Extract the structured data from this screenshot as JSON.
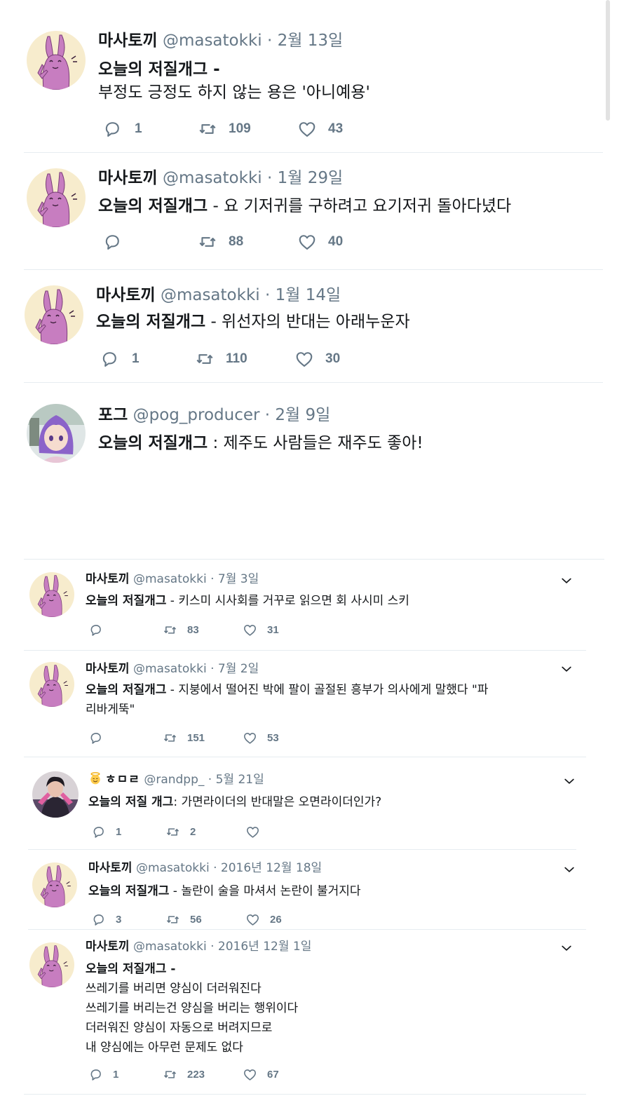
{
  "tweets": [
    {
      "name": "마사토끼",
      "handle": "@masatokki",
      "date": "2월 13일",
      "headline": "오늘의 저질개그 -",
      "lines": [
        "부정도 긍정도 하지 않는 용은 '아니예용'"
      ],
      "replies": "1",
      "retweets": "109",
      "likes": "43"
    },
    {
      "name": "마사토끼",
      "handle": "@masatokki",
      "date": "1월 29일",
      "headline": "오늘의 저질개그",
      "lines": [
        " - 요 기저귀를 구하려고 요기저귀 돌아다녔다"
      ],
      "replies": "",
      "retweets": "88",
      "likes": "40"
    },
    {
      "name": "마사토끼",
      "handle": "@masatokki",
      "date": "1월 14일",
      "headline": "오늘의 저질개그",
      "lines": [
        " - 위선자의 반대는 아래누운자"
      ],
      "replies": "1",
      "retweets": "110",
      "likes": "30"
    },
    {
      "name": "포그",
      "handle": "@pog_producer",
      "date": "2월 9일",
      "headline": "오늘의 저질개그",
      "lines": [
        " : 제주도 사람들은 재주도 좋아!"
      ]
    },
    {
      "name": "마사토끼",
      "handle": "@masatokki",
      "date": "7월 3일",
      "headline": "오늘의 저질개그",
      "lines": [
        " - 키스미 시사회를 거꾸로 읽으면 회 사시미 스키"
      ],
      "replies": "",
      "retweets": "83",
      "likes": "31"
    },
    {
      "name": "마사토끼",
      "handle": "@masatokki",
      "date": "7월 2일",
      "headline": "오늘의 저질개그",
      "lines": [
        " - 지붕에서 떨어진 박에 팔이 골절된 흥부가 의사에게 말했다 \"파",
        "리바게뚝\""
      ],
      "replies": "",
      "retweets": "151",
      "likes": "53"
    },
    {
      "name": "ㅎㅁㄹ",
      "handle": "@randpp_",
      "date": "5월 21일",
      "headline": "오늘의 저질 개그",
      "lines": [
        ": 가면라이더의 반대말은 오면라이더인가?"
      ],
      "replies": "1",
      "retweets": "2",
      "likes": ""
    },
    {
      "name": "마사토끼",
      "handle": "@masatokki",
      "date": "2016년 12월 18일",
      "headline": "오늘의 저질개그",
      "lines": [
        " - 놀란이 술을 마셔서 논란이 불거지다"
      ],
      "replies": "3",
      "retweets": "56",
      "likes": "26"
    },
    {
      "name": "마사토끼",
      "handle": "@masatokki",
      "date": "2016년 12월 1일",
      "headline": "오늘의 저질개그 -",
      "lines": [
        "쓰레기를 버리면 양심이 더러워진다",
        "쓰레기를 버리는건 양심을 버리는 행위이다",
        "더러워진 양심이 자동으로 버려지므로",
        "내 양심에는 아무런 문제도 없다"
      ],
      "replies": "1",
      "retweets": "223",
      "likes": "67"
    }
  ],
  "icons": {
    "reply": "reply-icon",
    "retweet": "retweet-icon",
    "like": "heart-icon",
    "caret": "chevron-down-icon",
    "emoji": "halo-emoji-icon"
  },
  "colors": {
    "text": "#14171a",
    "muted": "#657786",
    "divider": "#e6ecf0",
    "bunny": "#c77dc0",
    "avatar_bg": "#f7eccd"
  }
}
